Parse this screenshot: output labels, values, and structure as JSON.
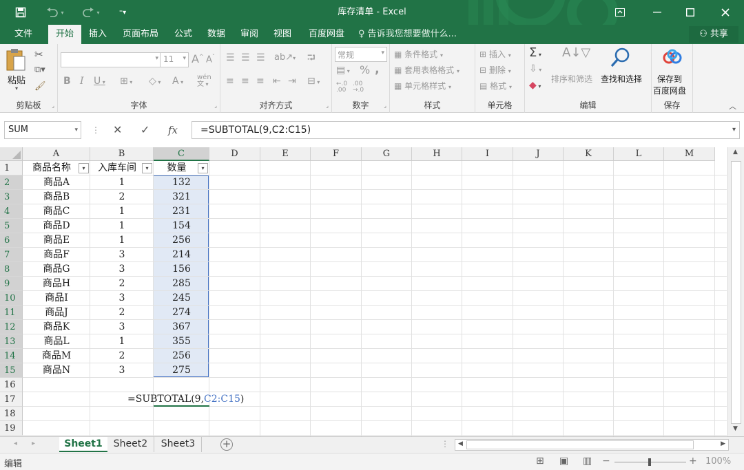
{
  "window": {
    "title": "库存清单 - Excel",
    "accent": "#217346"
  },
  "quick_access": {
    "save_icon": "save-icon",
    "undo_icon": "undo-icon",
    "redo_icon": "redo-icon",
    "customize_icon": "customize-icon"
  },
  "window_controls": {
    "ribbon_display_icon": "ribbon-display-icon",
    "minimize_icon": "minimize-icon",
    "maximize_icon": "maximize-icon",
    "close_icon": "close-icon"
  },
  "tabs": [
    {
      "label": "文件"
    },
    {
      "label": "开始"
    },
    {
      "label": "插入"
    },
    {
      "label": "页面布局"
    },
    {
      "label": "公式"
    },
    {
      "label": "数据"
    },
    {
      "label": "审阅"
    },
    {
      "label": "视图"
    },
    {
      "label": "百度网盘"
    }
  ],
  "tell_me": "告诉我您想要做什么...",
  "share": "共享",
  "ribbon": {
    "clipboard": {
      "label": "剪贴板",
      "paste": "粘贴"
    },
    "font": {
      "label": "字体",
      "size": "11",
      "bold": "B",
      "italic": "I",
      "underline": "U",
      "grow": "A",
      "shrink": "A",
      "font_color": "A",
      "wen": "wén"
    },
    "alignment": {
      "label": "对齐方式"
    },
    "number": {
      "label": "数字",
      "format": "常规",
      "percent": "%",
      "comma": ","
    },
    "styles": {
      "label": "样式",
      "conditional": "条件格式",
      "table": "套用表格格式",
      "cell_styles": "单元格样式"
    },
    "cells": {
      "label": "单元格",
      "insert": "插入",
      "delete": "删除",
      "format": "格式"
    },
    "editing": {
      "label": "编辑",
      "sort": "排序和筛选",
      "find": "查找和选择"
    },
    "save": {
      "label": "保存",
      "button_line1": "保存到",
      "button_line2": "百度网盘"
    }
  },
  "formula_bar": {
    "name_box": "SUM",
    "cancel_icon": "✕",
    "enter_icon": "✓",
    "fx": "fx",
    "formula": "=SUBTOTAL(9,C2:C15)"
  },
  "sheet": {
    "columns": [
      "A",
      "B",
      "C",
      "D",
      "E",
      "F",
      "G",
      "H",
      "I",
      "J",
      "K",
      "L",
      "M"
    ],
    "rows": [
      "1",
      "2",
      "3",
      "4",
      "5",
      "6",
      "7",
      "8",
      "9",
      "10",
      "11",
      "12",
      "13",
      "14",
      "15",
      "16",
      "17",
      "18",
      "19"
    ],
    "headers": [
      "商品名称",
      "入库车间",
      "数量"
    ],
    "data": [
      [
        "商品A",
        "1",
        "132"
      ],
      [
        "商品B",
        "2",
        "321"
      ],
      [
        "商品C",
        "1",
        "231"
      ],
      [
        "商品D",
        "1",
        "154"
      ],
      [
        "商品E",
        "1",
        "256"
      ],
      [
        "商品F",
        "3",
        "214"
      ],
      [
        "商品G",
        "3",
        "156"
      ],
      [
        "商品H",
        "2",
        "285"
      ],
      [
        "商品I",
        "3",
        "245"
      ],
      [
        "商品J",
        "2",
        "274"
      ],
      [
        "商品K",
        "3",
        "367"
      ],
      [
        "商品L",
        "1",
        "355"
      ],
      [
        "商品M",
        "2",
        "256"
      ],
      [
        "商品N",
        "3",
        "275"
      ]
    ],
    "edit_cell": {
      "prefix": "=SUBTOTAL(9,",
      "ref": "C2:C15",
      "suffix": ")",
      "ref_color": "#4472c4"
    }
  },
  "sheet_tabs": [
    "Sheet1",
    "Sheet2",
    "Sheet3"
  ],
  "status": {
    "mode": "编辑",
    "zoom": "100%"
  }
}
